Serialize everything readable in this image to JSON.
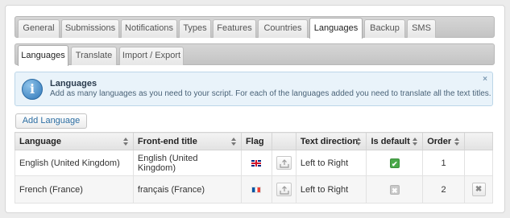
{
  "main_tabs": [
    {
      "label": "General",
      "active": false
    },
    {
      "label": "Submissions",
      "active": false
    },
    {
      "label": "Notifications",
      "active": false
    },
    {
      "label": "Types",
      "active": false
    },
    {
      "label": "Features",
      "active": false
    },
    {
      "label": "Countries",
      "active": false
    },
    {
      "label": "Languages",
      "active": true
    },
    {
      "label": "Backup",
      "active": false
    },
    {
      "label": "SMS",
      "active": false
    }
  ],
  "sub_tabs": [
    {
      "label": "Languages",
      "active": true
    },
    {
      "label": "Translate",
      "active": false
    },
    {
      "label": "Import / Export",
      "active": false
    }
  ],
  "info": {
    "icon": "info-icon",
    "glyph": "i",
    "title": "Languages",
    "text": "Add as many languages as you need to your script. For each of the languages added you need to translate all the text titles.",
    "close": "×"
  },
  "add_button": "Add Language",
  "table": {
    "headers": {
      "language": "Language",
      "title": "Front-end title",
      "flag": "Flag",
      "direction": "Text direction",
      "is_default": "Is default",
      "order": "Order"
    },
    "rows": [
      {
        "language": "English (United Kingdom)",
        "title": "English (United Kingdom)",
        "flag": "flag-uk-icon",
        "direction": "Left to Right",
        "is_default": true,
        "order": "1"
      },
      {
        "language": "French (France)",
        "title": "français (France)",
        "flag": "flag-fr-icon",
        "direction": "Left to Right",
        "is_default": false,
        "order": "2"
      }
    ],
    "checked_glyph": "✔",
    "unchecked_glyph": "✖",
    "delete_glyph": "✖"
  },
  "colors": {
    "accent_blue": "#2c6ea3",
    "default_green": "#4aa84a",
    "info_bg": "#e9f3fa"
  }
}
